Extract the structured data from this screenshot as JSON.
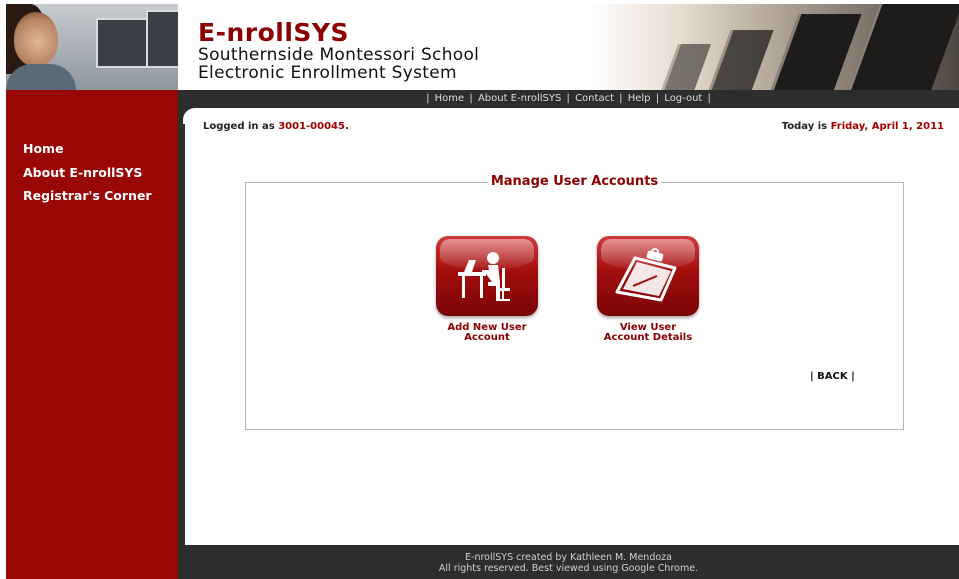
{
  "header": {
    "brand_name": "E-nrollSYS",
    "school_line": "Southernside Montessori School",
    "system_line": "Electronic Enrollment System"
  },
  "nav": {
    "items": [
      "Home",
      "About E-nrollSYS",
      "Contact",
      "Help",
      "Log-out"
    ],
    "separator": "|"
  },
  "sidebar": {
    "items": [
      {
        "label": "Home"
      },
      {
        "label": "About E-nrollSYS"
      },
      {
        "label": "Registrar's Corner"
      }
    ]
  },
  "status": {
    "logged_prefix": "Logged in as ",
    "user_id": "3001-00045",
    "logged_suffix": ".",
    "today_prefix": "Today is ",
    "date": "Friday, April 1, 2011"
  },
  "panel": {
    "title": "Manage User Accounts",
    "actions": [
      {
        "label_line1": "Add New User",
        "label_line2": "Account",
        "icon": "desk-user-icon"
      },
      {
        "label_line1": "View User",
        "label_line2": "Account Details",
        "icon": "clipboard-icon"
      }
    ],
    "back_label": "| BACK |"
  },
  "footer": {
    "line1": "E-nrollSYS created by Kathleen M. Mendoza",
    "line2": "All rights reserved. Best viewed using Google Chrome."
  },
  "colors": {
    "brand_red": "#980606",
    "dark_bar": "#2d2d2d",
    "text_red": "#8b0000"
  }
}
